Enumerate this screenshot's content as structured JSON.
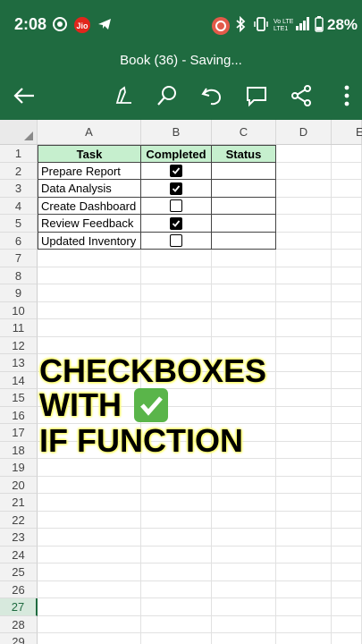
{
  "status_bar": {
    "time": "2:08",
    "battery": "28%",
    "icons": [
      "record-icon",
      "jio-icon",
      "telegram-icon",
      "screen-record-icon",
      "bluetooth-icon",
      "vibrate-icon",
      "lte-icon",
      "signal-icon",
      "battery-icon"
    ]
  },
  "title_bar": {
    "title": "Book (36) - Saving..."
  },
  "toolbar": {
    "icons": [
      "back-icon",
      "draw-icon",
      "search-icon",
      "undo-icon",
      "comment-icon",
      "share-icon",
      "more-icon"
    ]
  },
  "columns": [
    "A",
    "B",
    "C",
    "D",
    "E"
  ],
  "rows": [
    "1",
    "2",
    "3",
    "4",
    "5",
    "6",
    "7",
    "8",
    "9",
    "10",
    "11",
    "12",
    "13",
    "14",
    "15",
    "16",
    "17",
    "18",
    "19",
    "20",
    "21",
    "22",
    "23",
    "24",
    "25",
    "26",
    "27",
    "28",
    "29"
  ],
  "selected_row": "27",
  "table": {
    "headers": [
      "Task",
      "Completed",
      "Status"
    ],
    "tasks": [
      {
        "name": "Prepare Report",
        "completed": true
      },
      {
        "name": "Data Analysis",
        "completed": true
      },
      {
        "name": "Create Dashboard",
        "completed": false
      },
      {
        "name": "Review Feedback",
        "completed": true
      },
      {
        "name": "Updated Inventory",
        "completed": false
      }
    ]
  },
  "overlay": {
    "line1": "CHECKBOXES",
    "line2": "WITH",
    "line3": "IF FUNCTION"
  },
  "colors": {
    "brand_green": "#1f6b40",
    "header_fill": "#c6efce",
    "highlight": "#ffff66"
  }
}
